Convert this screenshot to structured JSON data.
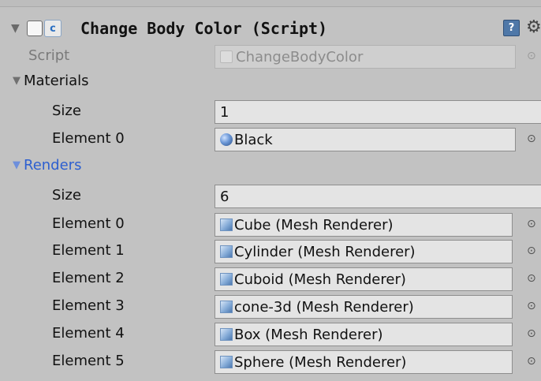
{
  "component": {
    "title": "Change Body Color (Script)",
    "script_label": "Script",
    "script_value": "ChangeBodyColor"
  },
  "materials": {
    "label": "Materials",
    "size_label": "Size",
    "size_value": "1",
    "elements": [
      {
        "label": "Element 0",
        "value": "Black"
      }
    ]
  },
  "renders": {
    "label": "Renders",
    "size_label": "Size",
    "size_value": "6",
    "elements": [
      {
        "label": "Element 0",
        "value": "Cube (Mesh Renderer)"
      },
      {
        "label": "Element 1",
        "value": "Cylinder (Mesh Renderer)"
      },
      {
        "label": "Element 2",
        "value": "Cuboid (Mesh Renderer)"
      },
      {
        "label": "Element 3",
        "value": "cone-3d (Mesh Renderer)"
      },
      {
        "label": "Element 4",
        "value": "Box (Mesh Renderer)"
      },
      {
        "label": "Element 5",
        "value": "Sphere (Mesh Renderer)"
      }
    ]
  },
  "icons": {
    "header_fold": "triangle-down-icon",
    "enabled": "checkbox-icon",
    "component": "csharp-script-icon",
    "help": "help-book-icon",
    "settings": "gear-icon",
    "material": "material-sphere-icon",
    "renderer": "mesh-renderer-icon",
    "object_picker": "object-picker-icon"
  },
  "colors": {
    "background": "#c2c2c2",
    "selected_text": "#2d5fd0",
    "field_bg": "#e4e4e4"
  }
}
